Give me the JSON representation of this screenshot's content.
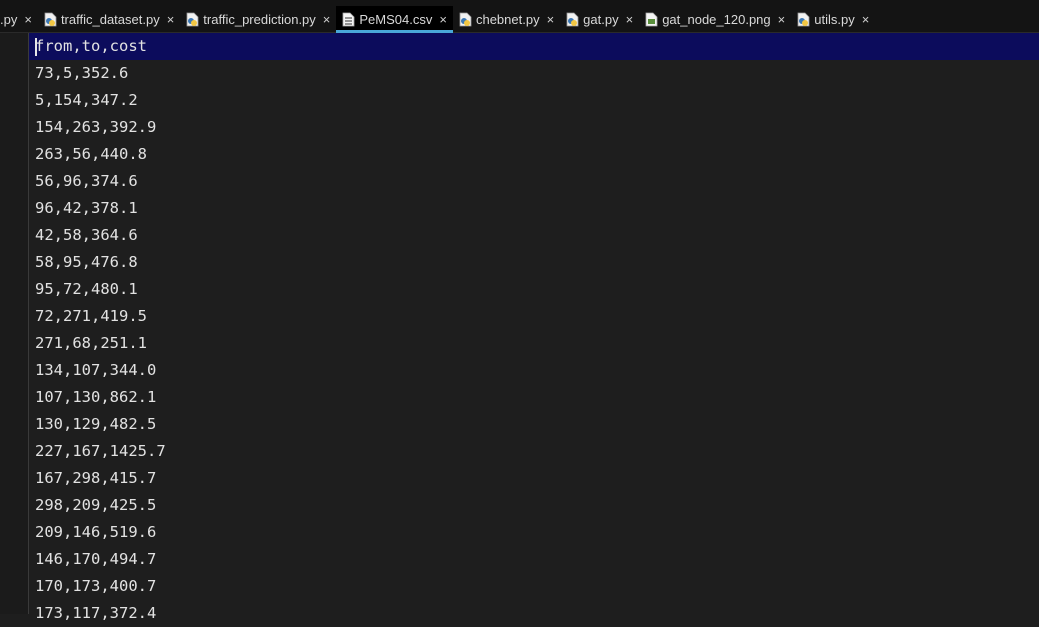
{
  "tabs": [
    {
      "label": ".py",
      "active": false,
      "icon": "python-file-icon"
    },
    {
      "label": "traffic_dataset.py",
      "active": false,
      "icon": "python-file-icon"
    },
    {
      "label": "traffic_prediction.py",
      "active": false,
      "icon": "python-file-icon"
    },
    {
      "label": "PeMS04.csv",
      "active": true,
      "icon": "csv-file-icon"
    },
    {
      "label": "chebnet.py",
      "active": false,
      "icon": "python-file-icon"
    },
    {
      "label": "gat.py",
      "active": false,
      "icon": "python-file-icon"
    },
    {
      "label": "gat_node_120.png",
      "active": false,
      "icon": "image-file-icon"
    },
    {
      "label": "utils.py",
      "active": false,
      "icon": "python-file-icon"
    }
  ],
  "close_glyph": "×",
  "lines": [
    "from,to,cost",
    "73,5,352.6",
    "5,154,347.2",
    "154,263,392.9",
    "263,56,440.8",
    "56,96,374.6",
    "96,42,378.1",
    "42,58,364.6",
    "58,95,476.8",
    "95,72,480.1",
    "72,271,419.5",
    "271,68,251.1",
    "134,107,344.0",
    "107,130,862.1",
    "130,129,482.5",
    "227,167,1425.7",
    "167,298,415.7",
    "298,209,425.5",
    "209,146,519.6",
    "146,170,494.7",
    "170,173,400.7",
    "173,117,372.4"
  ],
  "colors": {
    "editor_bg": "#1e1e1e",
    "current_line_bg": "#0c0c5c",
    "active_tab_underline": "#49a8d8",
    "text": "#e2e2e2"
  }
}
